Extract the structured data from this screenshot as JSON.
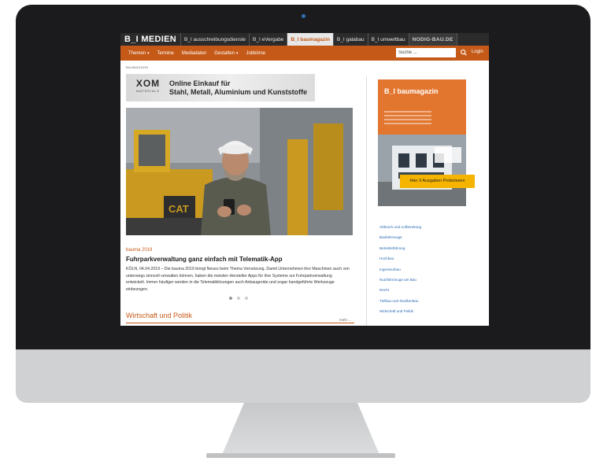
{
  "brand_bar": {
    "main": "B_I MEDIEN",
    "items": [
      "B_I ausschreibungsdienste",
      "B_I eVergabe",
      "B_I baumagazin",
      "B_I galabau",
      "B_I umweltbau"
    ],
    "active_index": 2,
    "logo": "NODIG-BAU.DE"
  },
  "nav": {
    "items": [
      {
        "label": "Themen",
        "dropdown": true
      },
      {
        "label": "Termine",
        "dropdown": false
      },
      {
        "label": "Mediadaten",
        "dropdown": false
      },
      {
        "label": "Gestalten",
        "dropdown": true
      },
      {
        "label": "Jobbörse",
        "dropdown": false
      }
    ],
    "search_placeholder": "Suche ...",
    "login": "Login",
    "color": "#c55a18"
  },
  "breadcrumb": "BAUMAGAZIN",
  "ad": {
    "logo": "XOM",
    "logo_sub": "MATERIALS",
    "line1": "Online Einkauf für",
    "line2": "Stahl, Metall, Aluminium und Kunststoffe"
  },
  "article": {
    "kicker": "bauma 2019",
    "headline": "Fuhrparkverwaltung ganz einfach mit Telematik-App",
    "teaser": "KÖLN, 04.04.2019 – Die bauma 2019 bringt Neues beim Thema Vernetzung. Damit Unternehmen ihre Maschinen auch von unterwegs sinnvoll verwalten können, haben die meisten Hersteller Apps für ihre Systeme zur Fuhrparkverwaltung entwickelt. Immer häufiger werden in die Telematiklösungen auch Anbaugeräte und sogar handgeführte Werkzeuge einbezogen."
  },
  "carousel": {
    "count": 3,
    "active": 0
  },
  "section": {
    "title": "Wirtschaft und Politik",
    "more": "mehr ..."
  },
  "magazine": {
    "title": "B_I baumagazin",
    "cta": "Hier 3 Ausgaben Probelesen"
  },
  "categories": [
    "Abbruch und Aufbereitung",
    "Baufahrzeuge",
    "Betriebsführung",
    "Hochbau",
    "Ingenieurbau",
    "Nutzfahrzeuge am Bau",
    "Recht",
    "Tiefbau und Straßenbau",
    "Wirtschaft und Politik"
  ]
}
